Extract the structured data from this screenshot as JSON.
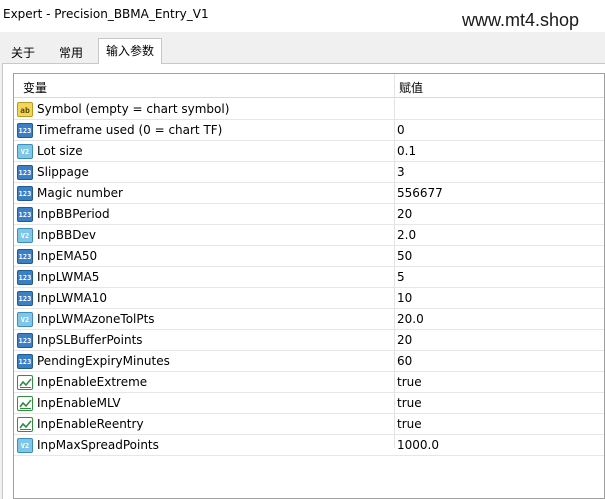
{
  "window": {
    "title": "Expert - Precision_BBMA_Entry_V1",
    "watermark": "www.mt4.shop"
  },
  "tabs": [
    {
      "label": "关于",
      "active": false
    },
    {
      "label": "常用",
      "active": false
    },
    {
      "label": "输入参数",
      "active": true
    }
  ],
  "grid": {
    "headers": {
      "variable": "变量",
      "value": "赋值"
    },
    "rows": [
      {
        "name": "Symbol (empty = chart symbol)",
        "value": "",
        "type": "string",
        "icon": "ab-string-icon",
        "badge": "ab"
      },
      {
        "name": "Timeframe used (0 = chart TF)",
        "value": "0",
        "type": "int",
        "icon": "int-123-icon",
        "badge": "123"
      },
      {
        "name": "Lot size",
        "value": "0.1",
        "type": "double",
        "icon": "double-v2-icon",
        "badge": "V2"
      },
      {
        "name": "Slippage",
        "value": "3",
        "type": "int",
        "icon": "int-123-icon",
        "badge": "123"
      },
      {
        "name": "Magic number",
        "value": "556677",
        "type": "int",
        "icon": "int-123-icon",
        "badge": "123"
      },
      {
        "name": "InpBBPeriod",
        "value": "20",
        "type": "int",
        "icon": "int-123-icon",
        "badge": "123"
      },
      {
        "name": "InpBBDev",
        "value": "2.0",
        "type": "double",
        "icon": "double-v2-icon",
        "badge": "V2"
      },
      {
        "name": "InpEMA50",
        "value": "50",
        "type": "int",
        "icon": "int-123-icon",
        "badge": "123"
      },
      {
        "name": "InpLWMA5",
        "value": "5",
        "type": "int",
        "icon": "int-123-icon",
        "badge": "123"
      },
      {
        "name": "InpLWMA10",
        "value": "10",
        "type": "int",
        "icon": "int-123-icon",
        "badge": "123"
      },
      {
        "name": "InpLWMAzoneTolPts",
        "value": "20.0",
        "type": "double",
        "icon": "double-v2-icon",
        "badge": "V2"
      },
      {
        "name": "InpSLBufferPoints",
        "value": "20",
        "type": "int",
        "icon": "int-123-icon",
        "badge": "123"
      },
      {
        "name": "PendingExpiryMinutes",
        "value": "60",
        "type": "int",
        "icon": "int-123-icon",
        "badge": "123"
      },
      {
        "name": "InpEnableExtreme",
        "value": "true",
        "type": "bool",
        "icon": "bool-check-icon",
        "badge": ""
      },
      {
        "name": "InpEnableMLV",
        "value": "true",
        "type": "bool",
        "icon": "bool-check-icon",
        "badge": ""
      },
      {
        "name": "InpEnableReentry",
        "value": "true",
        "type": "bool",
        "icon": "bool-check-icon",
        "badge": ""
      },
      {
        "name": "InpMaxSpreadPoints",
        "value": "1000.0",
        "type": "double",
        "icon": "double-v2-icon",
        "badge": "V2"
      }
    ]
  }
}
